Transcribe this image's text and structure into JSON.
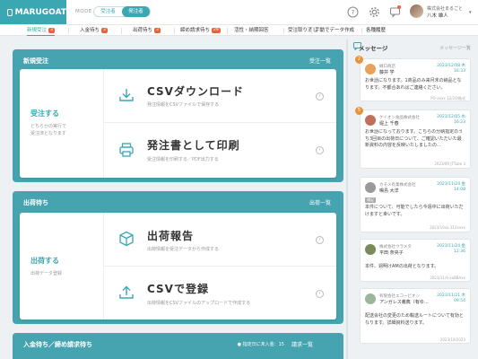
{
  "header": {
    "logo": "MARUGOAT",
    "mode_label": "MODE",
    "mode_order": "受注者",
    "mode_ship": "発注者",
    "help_icon": "question-circle-icon",
    "settings_icon": "gear-icon",
    "message_icon": "chat-bubble-icon",
    "user_company": "株式会社まるごと",
    "user_name": "八木 雄人",
    "caret": "▾"
  },
  "tabs": [
    {
      "label": "新規受注",
      "count": "3"
    },
    {
      "label": "入金待ち",
      "count": "3"
    },
    {
      "label": "出荷待ち",
      "count": "3"
    },
    {
      "label": "締め請求待ち",
      "count": "29"
    },
    {
      "label": "活性・納期回答",
      "count": ""
    },
    {
      "label": "受注取り消し",
      "count": ""
    },
    {
      "label": "手動でデータ作成",
      "count": ""
    },
    {
      "label": "各種履歴",
      "count": ""
    }
  ],
  "sections": {
    "new_order": {
      "title": "新規受注",
      "list_link": "受注一覧",
      "left_title": "受注する",
      "left_sub": "どちらかの実行で\n受注済となります",
      "rows": [
        {
          "title": "CSVダウンロード",
          "sub": "発注情報をCSVファイルで保存する"
        },
        {
          "title": "発注書として印刷",
          "sub": "受注情報を印刷する／PDF出力する"
        }
      ]
    },
    "shipping": {
      "title": "出荷待ち",
      "list_link": "出荷一覧",
      "left_title": "出荷する",
      "left_sub": "出荷データ登録",
      "rows": [
        {
          "title": "出荷報告",
          "sub": "出荷情報を受注データから作成する"
        },
        {
          "title": "CSVで登録",
          "sub": "出荷情報をCSVファイルのアップロードで作成する"
        }
      ]
    },
    "payment": {
      "title": "入金待ち／締め請求待ち",
      "note": "● 指定日に未入金：15",
      "list_link": "請求一覧"
    }
  },
  "messages": {
    "title": "メッセージ",
    "list_link": "メッセージ一覧",
    "items": [
      {
        "company": "緑口商店",
        "name": "藤井 学",
        "date": "2023/12/08 木",
        "time": "16:33",
        "unread": "2",
        "body": "お世話になります。1商品のみ来月末の納品となります。不都合あればご連絡ください。",
        "ref": "PO-xxxx 12/20/株式",
        "tag": "",
        "avatar": "#e8a25a"
      },
      {
        "company": "ケイオン食品株式会社",
        "name": "堀上 千春",
        "date": "2023/12/05 水",
        "time": "16:23",
        "unread": "5",
        "body": "お世話になっております。こちらの分納指定のうち3回目の出荷日について、ご確認いただいた最新資料の内容を反映いたしましたの…",
        "ref": "2023/09 JTTube 3",
        "tag": "",
        "avatar": "#c0705a"
      },
      {
        "company": "カモメ有業株式会社",
        "name": "鳴島 大洋",
        "date": "2023/11/24 金",
        "time": "14:08",
        "unread": "",
        "body": "本件について、可能でしたら今週中に出荷いただけますと幸いです。",
        "ref": "2023/10xx-112xxxx",
        "tag": "補足",
        "avatar": "#9a9a9a"
      },
      {
        "company": "株式会社ウラメタ",
        "name": "平田 奈央子",
        "date": "2023/11/24 金",
        "time": "12:36",
        "unread": "",
        "body": "本件、週明けAMの出荷となります。",
        "ref": "2023/11/4-xxBBAxx",
        "tag": "",
        "avatar": "#7a8a5a"
      },
      {
        "company": "有限会社エコーピオン",
        "name": "アンガレス義典（有ゆ…",
        "date": "2023/11/21 木",
        "time": "09:54",
        "unread": "",
        "body": "配送会社の変更のため輸送ルートについて有効となります。詳細資料送ります。",
        "ref": "2023/10/2023",
        "tag": "",
        "avatar": "#9ab79a"
      }
    ]
  }
}
